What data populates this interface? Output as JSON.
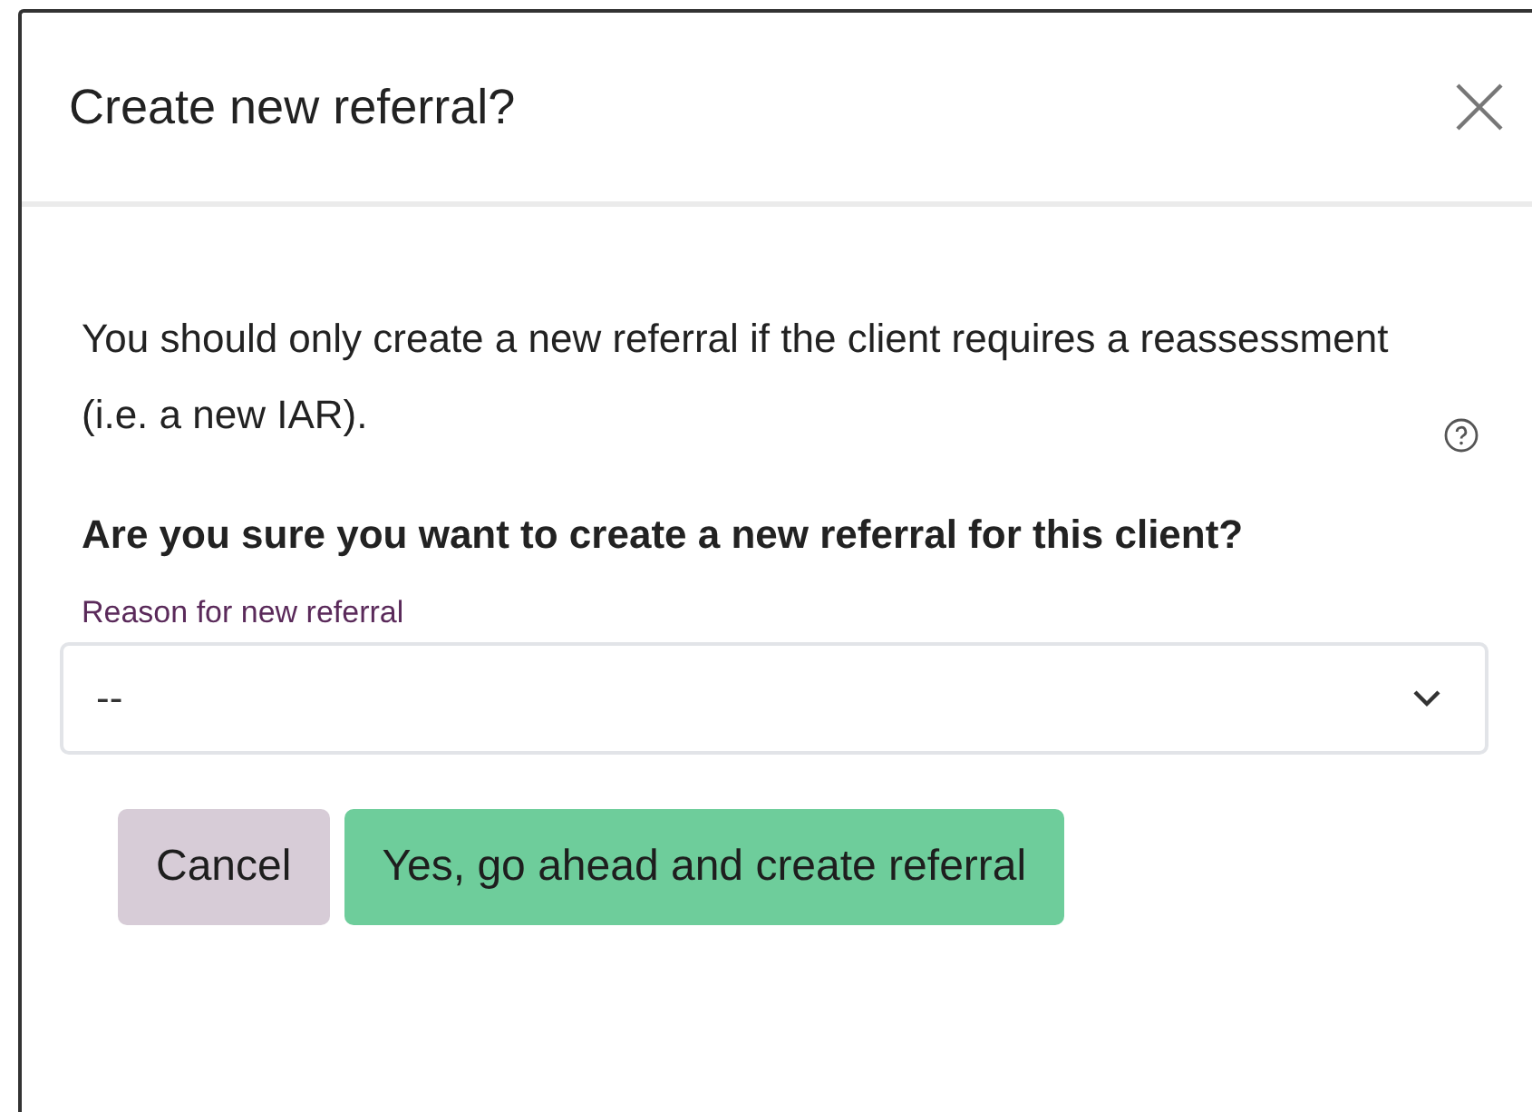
{
  "dialog": {
    "title": "Create new referral?",
    "message": "You should only create a new referral if the client requires a reassessment (i.e. a new IAR).",
    "question": "Are you sure you want to create a new referral for this client?",
    "reason_field": {
      "label": "Reason for new referral",
      "value": "--"
    },
    "buttons": [
      {
        "label": "Cancel",
        "kind": "secondary"
      },
      {
        "label": "Yes, go ahead and create referral",
        "kind": "primary"
      }
    ]
  }
}
